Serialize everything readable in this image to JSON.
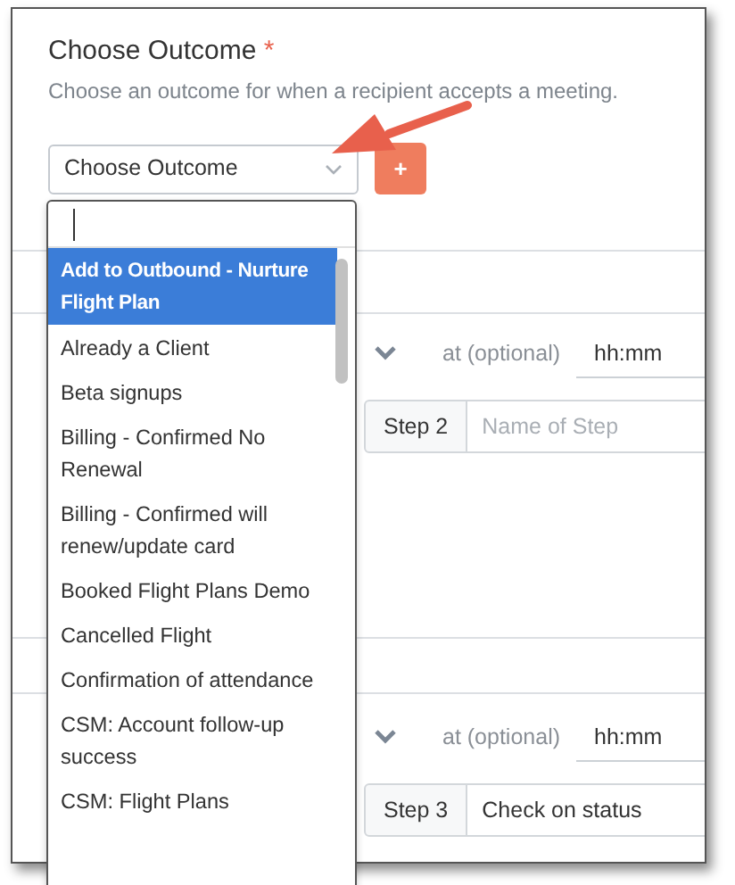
{
  "field": {
    "title": "Choose Outcome",
    "required_mark": "*",
    "description": "Choose an outcome for when a recipient accepts a meeting."
  },
  "select": {
    "value": "Choose Outcome",
    "expanded": true
  },
  "add_button": {
    "label": "+"
  },
  "dropdown": {
    "options": [
      {
        "label": "Add to Outbound - Nurture Flight Plan",
        "selected": true
      },
      {
        "label": "Already a Client",
        "selected": false
      },
      {
        "label": "Beta signups",
        "selected": false
      },
      {
        "label": "Billing - Confirmed No Renewal",
        "selected": false
      },
      {
        "label": "Billing - Confirmed will renew/update card",
        "selected": false
      },
      {
        "label": "Booked Flight Plans Demo",
        "selected": false
      },
      {
        "label": "Cancelled Flight",
        "selected": false
      },
      {
        "label": "Confirmation of attendance",
        "selected": false
      },
      {
        "label": "CSM: Account follow-up success",
        "selected": false
      },
      {
        "label": "CSM: Flight Plans",
        "selected": false
      }
    ]
  },
  "steps": [
    {
      "time_label": "at (optional)",
      "time_placeholder": "hh:mm",
      "step_label": "Step 2",
      "name_placeholder": "Name of Step"
    },
    {
      "time_label": "at (optional)",
      "time_placeholder": "hh:mm",
      "step_label": "Step 3",
      "name_value": "Check on status"
    }
  ]
}
